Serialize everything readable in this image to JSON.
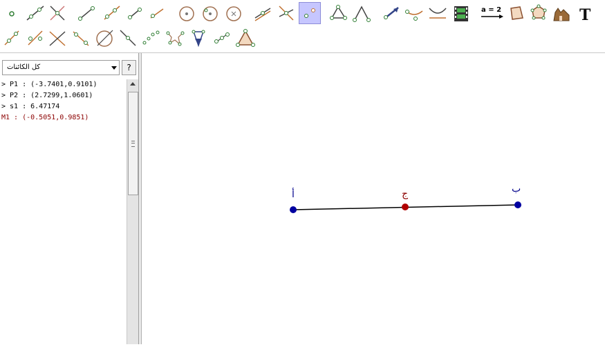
{
  "toolbar": {
    "row1": [
      "move-icon",
      "line-two-points-icon",
      "intersect-icon",
      "segment-icon",
      "ray-icon",
      "vector-icon",
      "polyline-icon",
      "circle-center-point-icon",
      "circle-radius-icon",
      "compass-icon",
      "perpendicular-icon",
      "angle-bisector-icon",
      "point-on-object-icon",
      "polygon-icon",
      "angle-icon",
      "reflect-icon",
      "locus-icon",
      "conic-icon",
      "slider-icon",
      "insert-image-icon",
      "equation-icon",
      "rigid-polygon-icon",
      "regular-polygon-icon",
      "function-inspector-icon",
      "text-icon"
    ],
    "row2": [
      "parallel-icon",
      "midpoint-icon",
      "perpendicular-bisector-icon",
      "tangent-icon",
      "circle-three-points-icon",
      "segment-fixed-icon",
      "sector-icon",
      "circle-arc-icon",
      "circumcircle-icon",
      "translate-icon",
      "attach-detach-icon",
      "triangle-icon"
    ],
    "selected_tool": "point-on-object-icon",
    "equation_label": "a = 2"
  },
  "algebra": {
    "filter_label": "كل الكائنات",
    "help_label": "?",
    "items": [
      {
        "text": "> P1 : (-3.7401,0.9101)",
        "dependent": false
      },
      {
        "text": "> P2 : (2.7299,1.0601)",
        "dependent": false
      },
      {
        "text": "> s1 : 6.47174",
        "dependent": false
      },
      {
        "text": "M1 : (-0.5051,0.9851)",
        "dependent": true
      }
    ]
  },
  "graphics": {
    "point_a_label": "أ",
    "point_b_label": "ب",
    "midpoint_label": "ج",
    "segment_color": "#000000",
    "point_color": "#0000a0",
    "midpoint_color": "#b00000"
  }
}
